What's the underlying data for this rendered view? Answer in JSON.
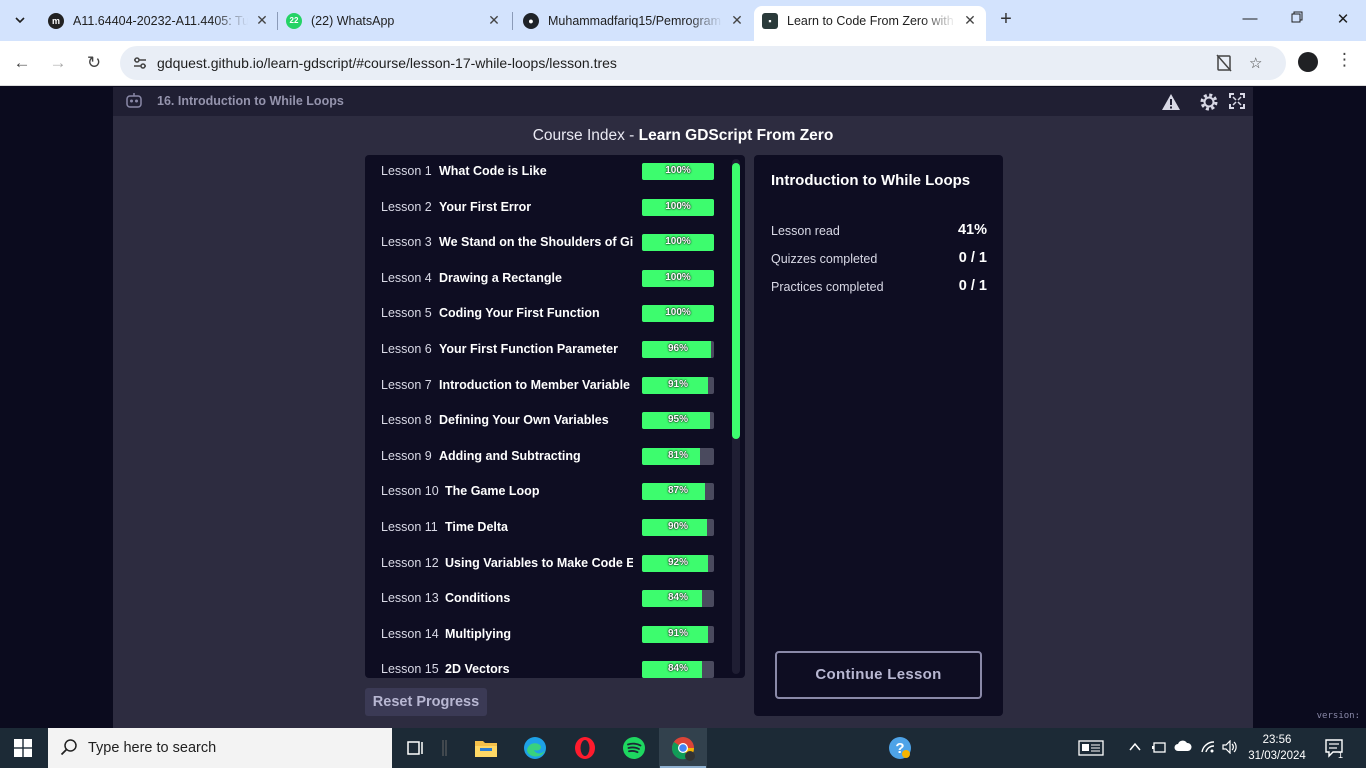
{
  "browser": {
    "tabs": [
      {
        "title": "A11.64404-20232-A11.4405: Tu",
        "active": false
      },
      {
        "title": "(22) WhatsApp",
        "active": false,
        "badge": "22"
      },
      {
        "title": "Muhammadfariq15/Pemrogram",
        "active": false
      },
      {
        "title": "Learn to Code From Zero with G",
        "active": true
      }
    ],
    "url": "gdquest.github.io/learn-gdscript/#course/lesson-17-while-loops/lesson.tres"
  },
  "app": {
    "current_lesson": "16. Introduction to While Loops",
    "heading_prefix": "Course Index - ",
    "heading_course": "Learn GDScript From Zero",
    "lessons": [
      {
        "num": "Lesson 1",
        "name": "What Code is Like",
        "pct_label": "100%",
        "pct": 100
      },
      {
        "num": "Lesson 2",
        "name": "Your First Error",
        "pct_label": "100%",
        "pct": 100
      },
      {
        "num": "Lesson 3",
        "name": "We Stand on the Shoulders of Gia",
        "pct_label": "100%",
        "pct": 100
      },
      {
        "num": "Lesson 4",
        "name": "Drawing a Rectangle",
        "pct_label": "100%",
        "pct": 100
      },
      {
        "num": "Lesson 5",
        "name": "Coding Your First Function",
        "pct_label": "100%",
        "pct": 100
      },
      {
        "num": "Lesson 6",
        "name": "Your First Function Parameter",
        "pct_label": "96%",
        "pct": 96
      },
      {
        "num": "Lesson 7",
        "name": "Introduction to Member Variable",
        "pct_label": "91%",
        "pct": 91
      },
      {
        "num": "Lesson 8",
        "name": "Defining Your Own Variables",
        "pct_label": "95%",
        "pct": 95
      },
      {
        "num": "Lesson 9",
        "name": "Adding and Subtracting",
        "pct_label": "81%",
        "pct": 81
      },
      {
        "num": "Lesson 10",
        "name": "The Game Loop",
        "pct_label": "87%",
        "pct": 87
      },
      {
        "num": "Lesson 11",
        "name": "Time Delta",
        "pct_label": "90%",
        "pct": 90
      },
      {
        "num": "Lesson 12",
        "name": "Using Variables to Make Code Ea",
        "pct_label": "92%",
        "pct": 92
      },
      {
        "num": "Lesson 13",
        "name": "Conditions",
        "pct_label": "84%",
        "pct": 84
      },
      {
        "num": "Lesson 14",
        "name": "Multiplying",
        "pct_label": "91%",
        "pct": 91
      },
      {
        "num": "Lesson 15",
        "name": "2D Vectors",
        "pct_label": "84%",
        "pct": 84
      }
    ],
    "reset_label": "Reset Progress",
    "detail": {
      "title": "Introduction to While Loops",
      "stats": [
        {
          "label": "Lesson read",
          "value": "41%"
        },
        {
          "label": "Quizzes completed",
          "value": "0 / 1"
        },
        {
          "label": "Practices completed",
          "value": "0 / 1"
        }
      ],
      "continue_label": "Continue Lesson"
    },
    "version_label": "version:"
  },
  "taskbar": {
    "search_placeholder": "Type here to search",
    "time": "23:56",
    "date": "31/03/2024",
    "notification_count": "1"
  },
  "colors": {
    "progress_fill": "#3dfc6e",
    "panel_bg": "#0e0d22",
    "app_bg": "#2d2c40"
  }
}
